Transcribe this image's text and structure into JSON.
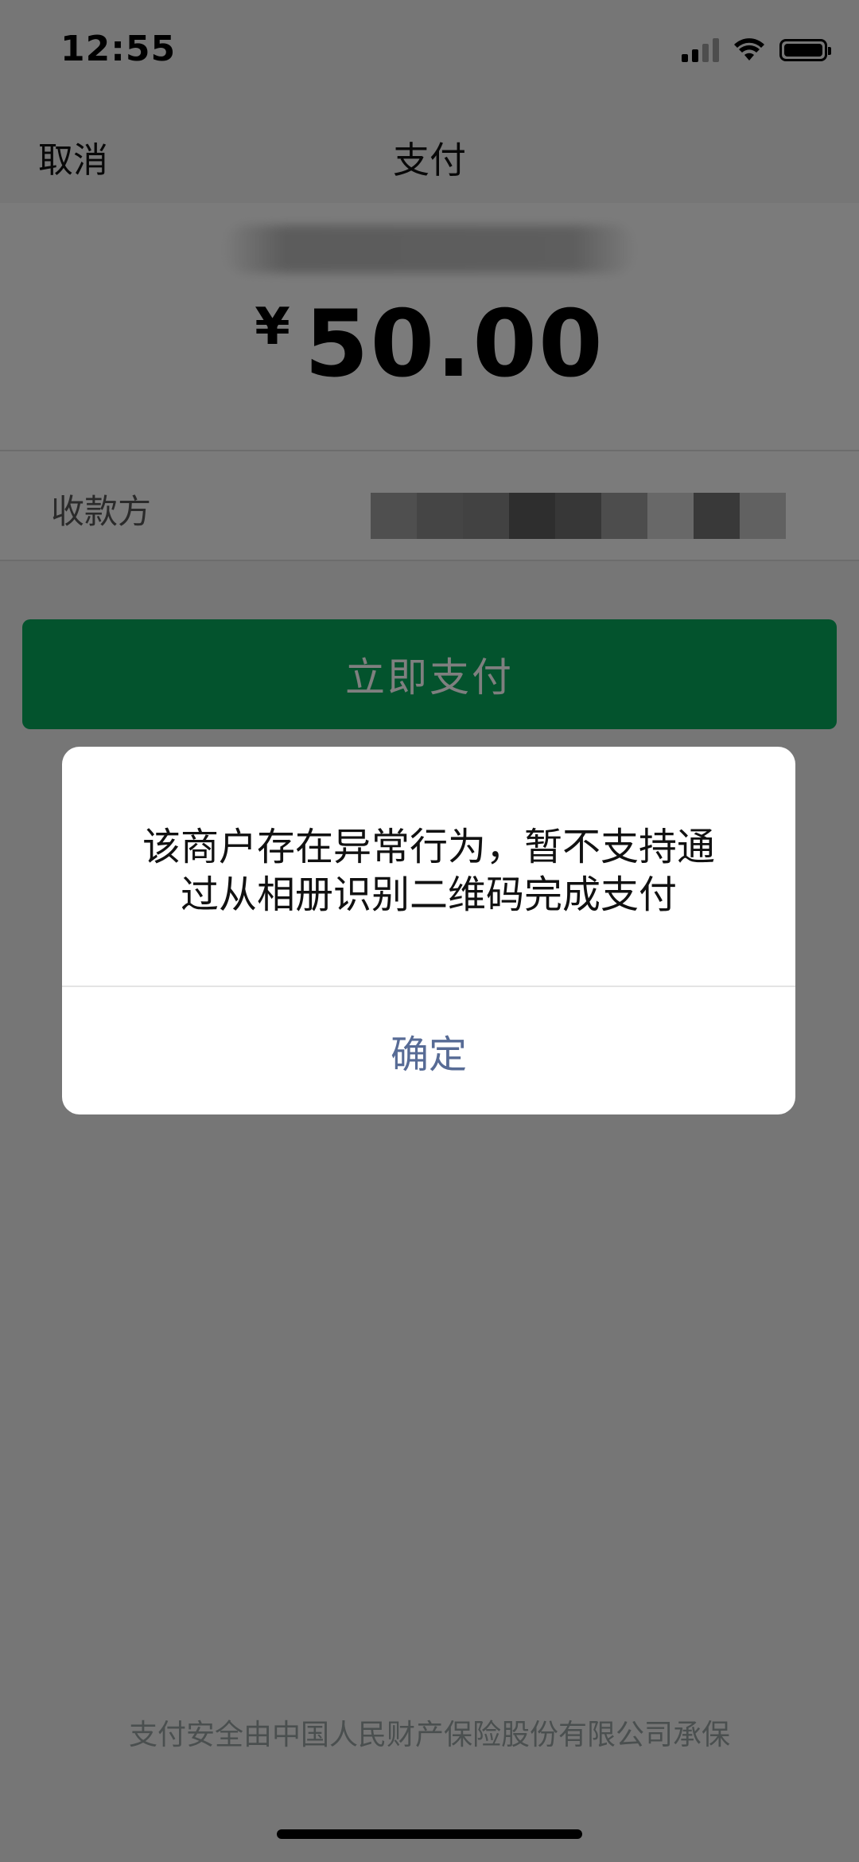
{
  "status_bar": {
    "time": "12:55",
    "icons": [
      "cellular-signal-icon",
      "wifi-icon",
      "battery-icon"
    ]
  },
  "nav": {
    "cancel_label": "取消",
    "title": "支付"
  },
  "summary": {
    "currency_symbol": "¥",
    "amount": "50.00"
  },
  "payee": {
    "label": "收款方"
  },
  "pay_button": {
    "label": "立即支付",
    "color": "#07a65a"
  },
  "dialog": {
    "message_line1": "该商户存在异常行为，暂不支持通",
    "message_line2": "过从相册识别二维码完成支付",
    "confirm_label": "确定",
    "confirm_color": "#576b95"
  },
  "footer": {
    "insurance_text": "支付安全由中国人民财产保险股份有限公司承保"
  }
}
